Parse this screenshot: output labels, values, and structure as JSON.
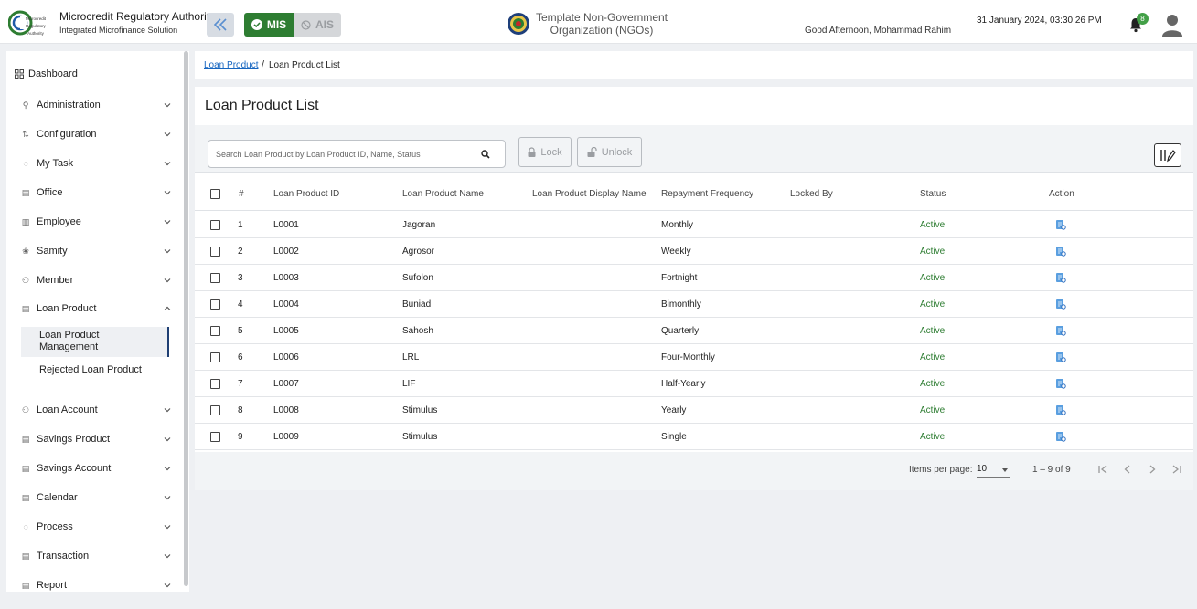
{
  "header": {
    "brand_title": "Microcredit Regulatory Authority",
    "brand_subtitle": "Integrated Microfinance Solution",
    "logo_text": "Microcredit Regulatory Authority",
    "mis_label": "MIS",
    "ais_label": "AIS",
    "org_name_line1": "Template Non-Government",
    "org_name_line2": "Organization (NGOs)",
    "greeting": "Good Afternoon, Mohammad Rahim",
    "datetime": "31 January 2024, 03:30:26 PM",
    "notification_count": "8"
  },
  "sidebar": {
    "dashboard_label": "Dashboard",
    "items": [
      {
        "label": "Administration",
        "icon": "admin-icon"
      },
      {
        "label": "Configuration",
        "icon": "config-icon"
      },
      {
        "label": "My Task",
        "icon": "task-icon"
      },
      {
        "label": "Office",
        "icon": "office-icon"
      },
      {
        "label": "Employee",
        "icon": "employee-icon"
      },
      {
        "label": "Samity",
        "icon": "samity-icon"
      },
      {
        "label": "Member",
        "icon": "member-icon"
      },
      {
        "label": "Loan Product",
        "icon": "loan-product-icon"
      },
      {
        "label": "Loan Account",
        "icon": "loan-account-icon"
      },
      {
        "label": "Savings Product",
        "icon": "savings-product-icon"
      },
      {
        "label": "Savings Account",
        "icon": "savings-account-icon"
      },
      {
        "label": "Calendar",
        "icon": "calendar-icon"
      },
      {
        "label": "Process",
        "icon": "process-icon"
      },
      {
        "label": "Transaction",
        "icon": "transaction-icon"
      },
      {
        "label": "Report",
        "icon": "report-icon"
      }
    ],
    "loan_product_sub": [
      {
        "label": "Loan Product Management",
        "line1": "Loan Product",
        "line2": "Management"
      },
      {
        "label": "Rejected Loan Product"
      }
    ]
  },
  "breadcrumb": {
    "parent": "Loan Product",
    "separator": "/",
    "current": "Loan Product List"
  },
  "page": {
    "title": "Loan Product List",
    "search_placeholder": "Search Loan Product by Loan Product ID, Name, Status",
    "lock_label": "Lock",
    "unlock_label": "Unlock"
  },
  "table": {
    "columns": [
      "#",
      "Loan Product ID",
      "Loan Product Name",
      "Loan Product Display Name",
      "Repayment Frequency",
      "Locked By",
      "Status",
      "Action"
    ],
    "rows": [
      {
        "n": "1",
        "id": "L0001",
        "name": "Jagoran",
        "display": "",
        "freq": "Monthly",
        "locked": "",
        "status": "Active"
      },
      {
        "n": "2",
        "id": "L0002",
        "name": "Agrosor",
        "display": "",
        "freq": "Weekly",
        "locked": "",
        "status": "Active"
      },
      {
        "n": "3",
        "id": "L0003",
        "name": "Sufolon",
        "display": "",
        "freq": "Fortnight",
        "locked": "",
        "status": "Active"
      },
      {
        "n": "4",
        "id": "L0004",
        "name": "Buniad",
        "display": "",
        "freq": "Bimonthly",
        "locked": "",
        "status": "Active"
      },
      {
        "n": "5",
        "id": "L0005",
        "name": "Sahosh",
        "display": "",
        "freq": "Quarterly",
        "locked": "",
        "status": "Active"
      },
      {
        "n": "6",
        "id": "L0006",
        "name": "LRL",
        "display": "",
        "freq": "Four-Monthly",
        "locked": "",
        "status": "Active"
      },
      {
        "n": "7",
        "id": "L0007",
        "name": "LIF",
        "display": "",
        "freq": "Half-Yearly",
        "locked": "",
        "status": "Active"
      },
      {
        "n": "8",
        "id": "L0008",
        "name": "Stimulus",
        "display": "",
        "freq": "Yearly",
        "locked": "",
        "status": "Active"
      },
      {
        "n": "9",
        "id": "L0009",
        "name": "Stimulus",
        "display": "",
        "freq": "Single",
        "locked": "",
        "status": "Active"
      }
    ]
  },
  "pagination": {
    "items_per_page_label": "Items per page:",
    "items_per_page": "10",
    "range": "1 – 9 of 9"
  },
  "colors": {
    "accent_green": "#2e7d32",
    "link_blue": "#1565c0",
    "status_active": "#2e7d32"
  }
}
